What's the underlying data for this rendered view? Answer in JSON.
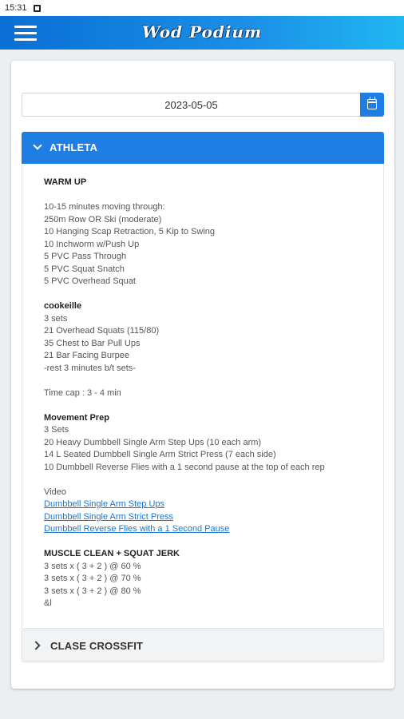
{
  "status_bar": {
    "time": "15:31"
  },
  "app_bar": {
    "title": "Wod Podium"
  },
  "date_picker": {
    "value": "2023-05-05"
  },
  "sections": [
    {
      "title": "ATHLETA"
    },
    {
      "title": "CLASE CROSSFIT"
    }
  ],
  "workout": {
    "warmup_title": "WARM UP",
    "warmup_lines": [
      "10-15 minutes moving through:",
      "250m Row OR Ski (moderate)",
      "10 Hanging Scap Retraction, 5 Kip to Swing",
      "10 Inchworm w/Push Up",
      "5 PVC Pass Through",
      "5 PVC Squat Snatch",
      "5 PVC Overhead Squat"
    ],
    "wod_title": "cookeille",
    "wod_lines": [
      "3 sets",
      "21 Overhead Squats (115/80)",
      "35 Chest to Bar Pull Ups",
      "21 Bar Facing Burpee",
      "-rest 3 minutes b/t sets-"
    ],
    "time_cap": "Time cap : 3 - 4 min",
    "prep_title": "Movement Prep",
    "prep_lines": [
      "3 Sets",
      "20 Heavy Dumbbell Single Arm Step Ups (10 each arm)",
      "14 L Seated Dumbbell Single Arm Strict Press (7 each side)",
      "10 Dumbbell Reverse Flies with a 1 second pause at the top of each rep"
    ],
    "video_label": "Video",
    "video_links": [
      "Dumbbell Single Arm Step Ups",
      "Dumbbell Single Arm Strict Press",
      "Dumbbell Reverse Flies with a 1 Second Pause"
    ],
    "lift_title": "MUSCLE CLEAN + SQUAT JERK",
    "lift_lines": [
      "3 sets x ( 3 + 2 ) @ 60 %",
      "3 sets x ( 3 + 2 ) @ 70 %",
      "3 sets x ( 3 + 2 ) @ 80 %",
      "&l"
    ]
  }
}
